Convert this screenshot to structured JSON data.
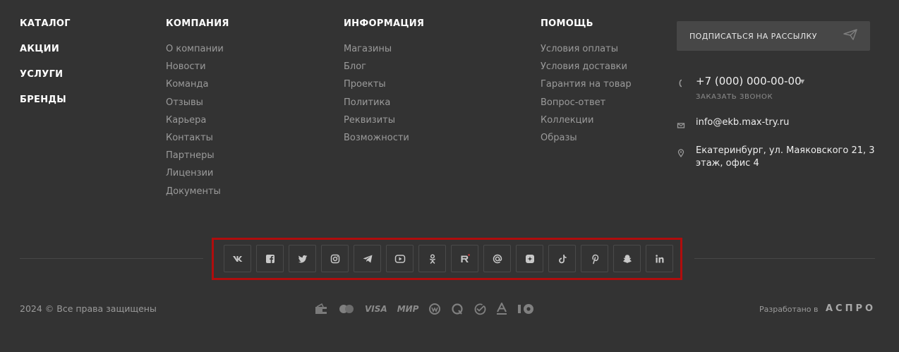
{
  "catalog_links": [
    "КАТАЛОГ",
    "АКЦИИ",
    "УСЛУГИ",
    "БРЕНДЫ"
  ],
  "company": {
    "title": "КОМПАНИЯ",
    "links": [
      "О компании",
      "Новости",
      "Команда",
      "Отзывы",
      "Карьера",
      "Контакты",
      "Партнеры",
      "Лицензии",
      "Документы"
    ]
  },
  "info": {
    "title": "ИНФОРМАЦИЯ",
    "links": [
      "Магазины",
      "Блог",
      "Проекты",
      "Политика",
      "Реквизиты",
      "Возможности"
    ]
  },
  "help": {
    "title": "ПОМОЩЬ",
    "links": [
      "Условия оплаты",
      "Условия доставки",
      "Гарантия на товар",
      "Вопрос-ответ",
      "Коллекции",
      "Образы"
    ]
  },
  "subscribe": {
    "label": "ПОДПИСАТЬСЯ НА РАССЫЛКУ",
    "icon": "send-icon"
  },
  "contacts": {
    "phone": "+7 (000) 000-00-00",
    "callback": "ЗАКАЗАТЬ ЗВОНОК",
    "email": "info@ekb.max-try.ru",
    "address": "Екатеринбург, ул. Маяковского 21, 3 этаж, офис 4"
  },
  "social": [
    "vk-icon",
    "facebook-icon",
    "twitter-icon",
    "instagram-icon",
    "telegram-icon",
    "youtube-icon",
    "odnoklassniki-icon",
    "rutube-icon",
    "mail-ru-icon",
    "dzen-icon",
    "tiktok-icon",
    "pinterest-icon",
    "snapchat-icon",
    "linkedin-icon"
  ],
  "copyright": "2024 © Все права защищены",
  "payments": {
    "visa": "VISA",
    "mir": "МИР"
  },
  "developer": {
    "label": "Разработано в",
    "logo": "АСПРО"
  },
  "colors": {
    "background": "#333333",
    "highlight_frame": "#b00d0d"
  }
}
